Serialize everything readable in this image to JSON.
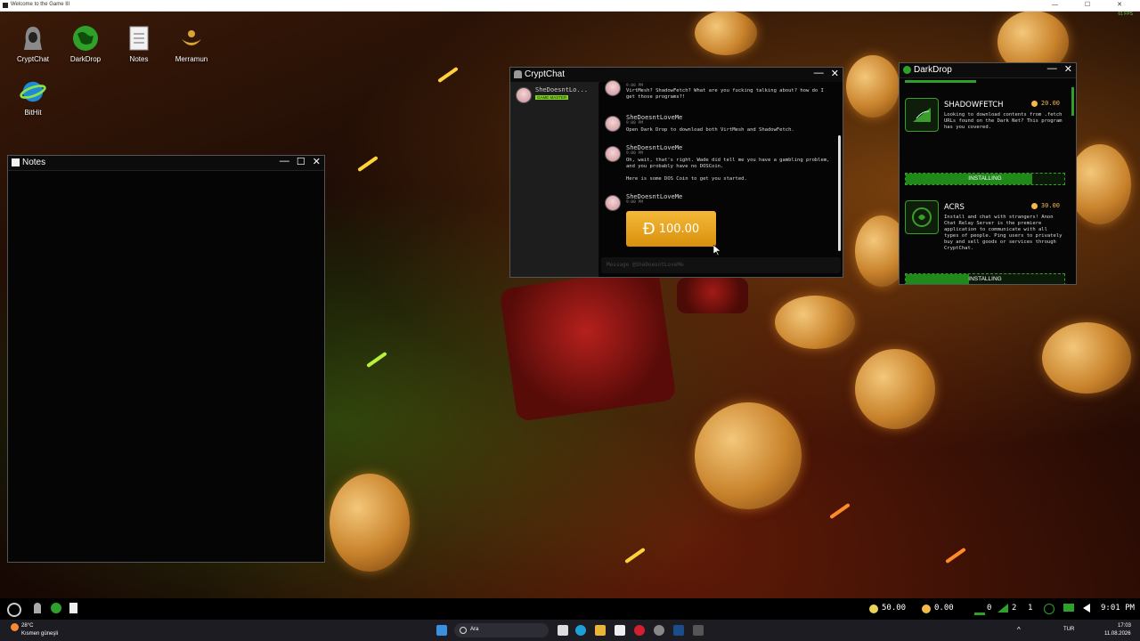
{
  "os_titlebar": {
    "title": "Welcome to the Game III",
    "fps": "61 FPS",
    "controls": "— ☐ ✕"
  },
  "desktop_icons": [
    {
      "label": "CryptChat"
    },
    {
      "label": "DarkDrop"
    },
    {
      "label": "Notes"
    },
    {
      "label": "Merramun"
    },
    {
      "label": "BitHit"
    }
  ],
  "notes_window": {
    "title": "Notes",
    "controls": [
      "—",
      "☐",
      "✕"
    ]
  },
  "cryptchat": {
    "title": "CryptChat",
    "controls": [
      "—",
      "✕"
    ],
    "contact": {
      "name": "SheDoesntLo...",
      "badge": "GAME MASTER"
    },
    "messages": [
      {
        "name": "",
        "time": "9:00 PM",
        "text": "VirtMesh? ShadowFetch? What are you fucking talking about? how do I get those programs?!"
      },
      {
        "name": "SheDoesntLoveMe",
        "time": "9:00 PM",
        "text": "Open Dark Drop to download both VirtMesh and ShadowFetch."
      },
      {
        "name": "SheDoesntLoveMe",
        "time": "9:00 PM",
        "text": "Oh, wait, that's right. Wade did tell me you have a gambling problem, and you probably have no DOSCoin.\n\nHere is some DOS Coin to get you started."
      },
      {
        "name": "SheDoesntLoveMe",
        "time": "9:00 PM",
        "text": ""
      }
    ],
    "coin_amount": "100.00",
    "coin_symbol": "Đ",
    "input_placeholder": "Message @SheDoesntLoveMe"
  },
  "darkdrop": {
    "title": "DarkDrop",
    "controls": [
      "—",
      "✕"
    ],
    "items": [
      {
        "name": "SHADOWFETCH",
        "price": "20.00",
        "description": "Looking to download contents from .fetch URLs found on the Dark Net? This program has you covered.",
        "status": "INSTALLING",
        "progress": 0.8
      },
      {
        "name": "ACRS",
        "price": "30.00",
        "description": "Install and chat with strangers! Anon Chat Relay Server is the premiere application to communicate with all types of people. Ping users to privately buy and sell goods or services through CryptChat.",
        "status": "INSTALLING",
        "progress": 0.4
      }
    ]
  },
  "gamebar": {
    "sun_value": "50.00",
    "coin_value": "0.00",
    "net_a": "0",
    "net_b": "2",
    "count": "1",
    "clock": "9:01 PM"
  },
  "taskbar": {
    "weather_temp": "28°C",
    "weather_desc": "Kısmen güneşli",
    "search_placeholder": "Ara",
    "language": "TUR",
    "time": "17:03",
    "date": "11.08.2026"
  },
  "colors": {
    "accent_green": "#3b9e2b",
    "coin_gold": "#f1b84a"
  }
}
